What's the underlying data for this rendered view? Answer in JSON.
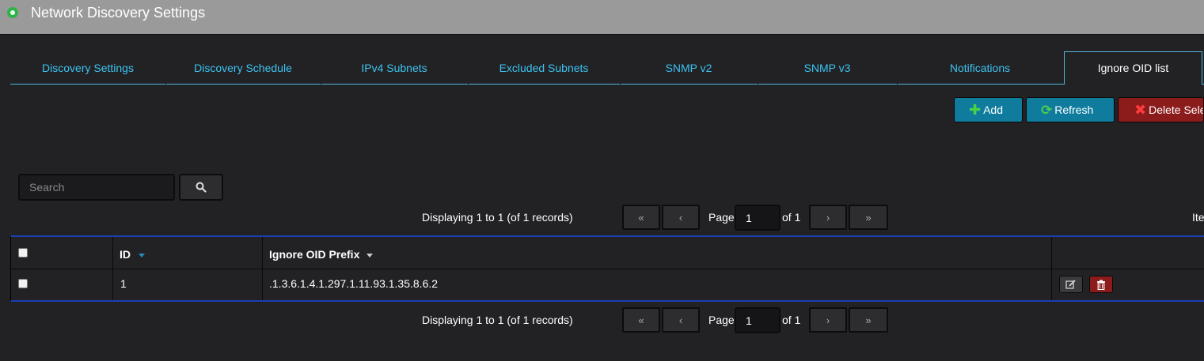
{
  "window": {
    "title": "Network Discovery Settings"
  },
  "tabs": [
    {
      "label": "Discovery Settings",
      "active": false
    },
    {
      "label": "Discovery Schedule",
      "active": false
    },
    {
      "label": "IPv4 Subnets",
      "active": false
    },
    {
      "label": "Excluded Subnets",
      "active": false
    },
    {
      "label": "SNMP v2",
      "active": false
    },
    {
      "label": "SNMP v3",
      "active": false
    },
    {
      "label": "Notifications",
      "active": false
    },
    {
      "label": "Ignore OID list",
      "active": true
    }
  ],
  "toolbar": {
    "add_label": "Add",
    "refresh_label": "Refresh",
    "delete_label": "Delete Sele"
  },
  "search": {
    "placeholder": "Search"
  },
  "pager_top": {
    "summary": "Displaying 1 to 1 (of 1 records)",
    "first": "«",
    "prev": "‹",
    "page_label": "Page",
    "page_value": "1",
    "of_label": "of 1",
    "next": "›",
    "last": "»",
    "items_label_cut": "Ite"
  },
  "pager_bottom": {
    "summary": "Displaying 1 to 1 (of 1 records)",
    "first": "«",
    "prev": "‹",
    "page_label": "Page",
    "page_value": "1",
    "of_label": "of 1",
    "next": "›",
    "last": "»"
  },
  "grid": {
    "columns": [
      {
        "label": ""
      },
      {
        "label": "ID",
        "sort": "desc"
      },
      {
        "label": "Ignore OID Prefix",
        "sort": "desc"
      },
      {
        "label": ""
      }
    ],
    "rows": [
      {
        "id": "1",
        "prefix": ".1.3.6.1.4.1.297.1.11.93.1.35.8.6.2"
      }
    ]
  },
  "colors": {
    "titlebar": "#9a9a9a",
    "background": "#222225",
    "tab_text": "#3cc3f0",
    "tab_border": "#4fb8d8",
    "button_blue": "#0f7c9e",
    "button_red": "#8c1c1c",
    "grid_border": "#1a3fb4",
    "sort_arrow_id": "#2a8cc0",
    "sort_arrow_prefix": "#cccccc"
  },
  "icons": {
    "title": "status-dot-icon",
    "add": "plus-icon",
    "refresh": "refresh-icon",
    "delete": "x-icon",
    "search": "magnifier-icon",
    "edit": "edit-icon",
    "trash": "trash-icon"
  }
}
